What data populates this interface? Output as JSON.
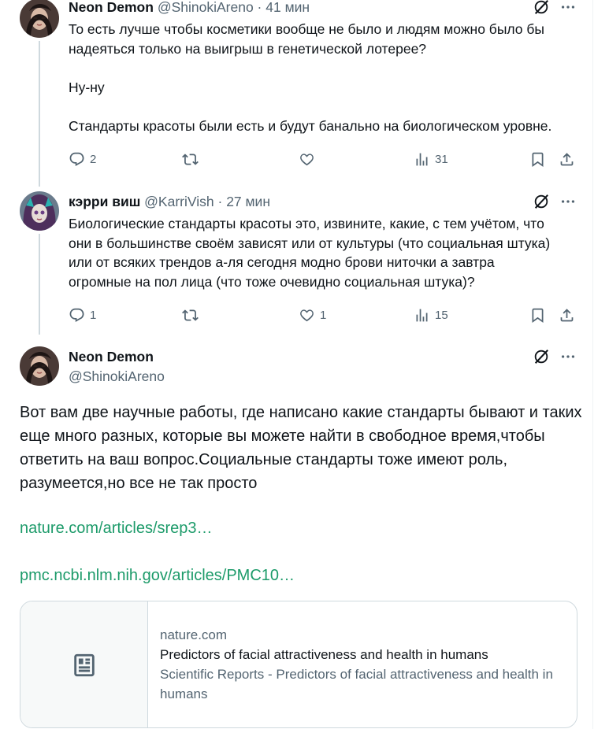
{
  "tweets": [
    {
      "name": "Neon Demon",
      "handle": "@ShinokiAreno",
      "time": "· 41 мин",
      "text": "То есть лучше чтобы косметики вообще не было и людям можно было бы\nнадеяться только на выигрыш в генетической лотерее?\n\nНу-ну\n\nСтандарты красоты были есть и будут банально на биологическом уровне.",
      "replies": "2",
      "reposts": "",
      "likes": "",
      "views": "31"
    },
    {
      "name": "кэрри виш",
      "handle": "@KarriVish",
      "time": "· 27 мин",
      "text": "Биологические стандарты красоты это, извините, какие, с тем учётом, что\nони в большинстве своём зависят или от культуры (что социальная штука)\nили от всяких трендов а-ля сегодня модно брови ниточки а завтра\nогромные на пол лица (что тоже очевидно социальная штука)?",
      "replies": "1",
      "reposts": "",
      "likes": "1",
      "views": "15"
    }
  ],
  "main": {
    "name": "Neon Demon",
    "handle": "@ShinokiAreno",
    "text": "Вот вам две научные работы, где написано какие стандарты бывают и таких еще много разных, которые вы можете найти в свободное время,чтобы ответить на ваш вопрос.Социальные стандарты тоже имеют роль, разумеется,но все не так просто",
    "link1": "nature.com/articles/srep3…",
    "link2": "pmc.ncbi.nlm.nih.gov/articles/PMC10…",
    "card": {
      "domain": "nature.com",
      "title": "Predictors of facial attractiveness and health in humans",
      "description": "Scientific Reports - Predictors of facial attractiveness and health in humans"
    }
  },
  "icons": {
    "grok": "grok-icon",
    "more": "more-icon",
    "reply": "reply-icon",
    "repost": "repost-icon",
    "like": "heart-icon",
    "views": "views-icon",
    "bookmark": "bookmark-icon",
    "share": "share-icon",
    "article": "article-icon"
  },
  "colors": {
    "link": "#1d9b6a",
    "secondary": "#536471",
    "border": "#cfd9de"
  }
}
